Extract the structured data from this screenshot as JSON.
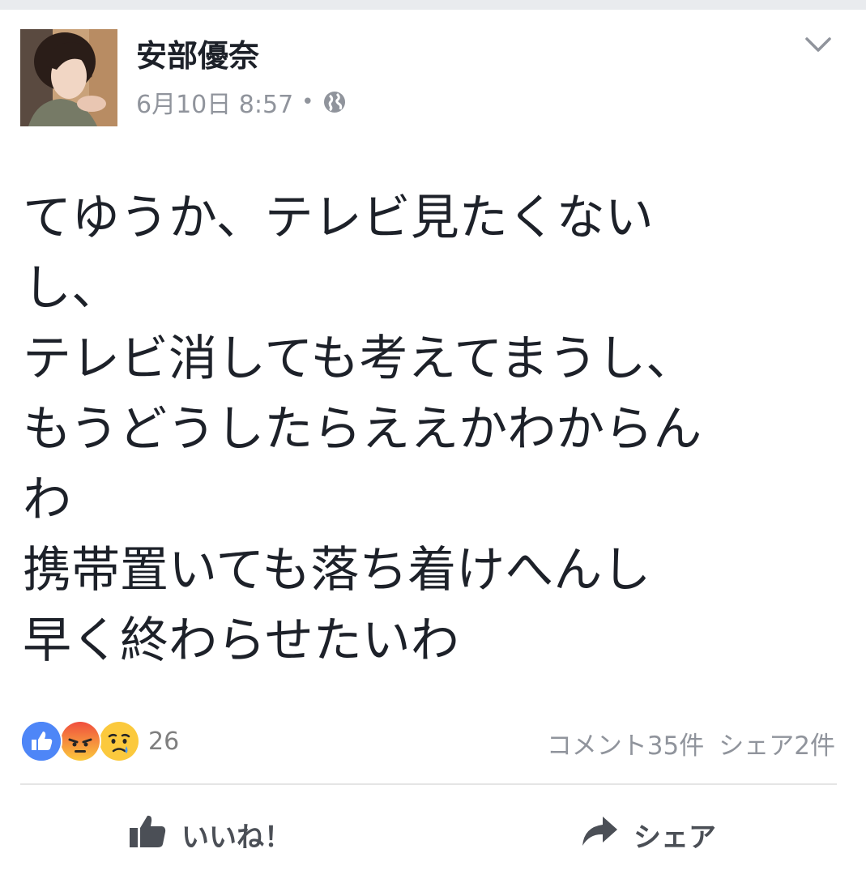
{
  "post": {
    "author": "安部優奈",
    "date": "6月10日 8:57",
    "separator": "•",
    "visibility_icon": "globe-icon",
    "menu_icon": "chevron-down-icon",
    "text": "てゆうか、テレビ見たくない\nし、\nテレビ消しても考えてまうし、\nもうどうしたらええかわからん\nわ\n携帯置いても落ち着けへんし\n早く終わらせたいわ"
  },
  "reactions": {
    "icons": [
      "like-icon",
      "angry-icon",
      "sad-icon"
    ],
    "count": "26"
  },
  "stats": {
    "comments": "コメント35件",
    "shares": "シェア2件"
  },
  "actions": {
    "like_label": "いいね！",
    "share_label": "シェア"
  },
  "colors": {
    "like_blue": "#4e86f7",
    "angry_red": "#f04e3e",
    "sad_yellow": "#fbc93d",
    "secondary_text": "#90949c",
    "action_gray": "#4b4f56"
  }
}
